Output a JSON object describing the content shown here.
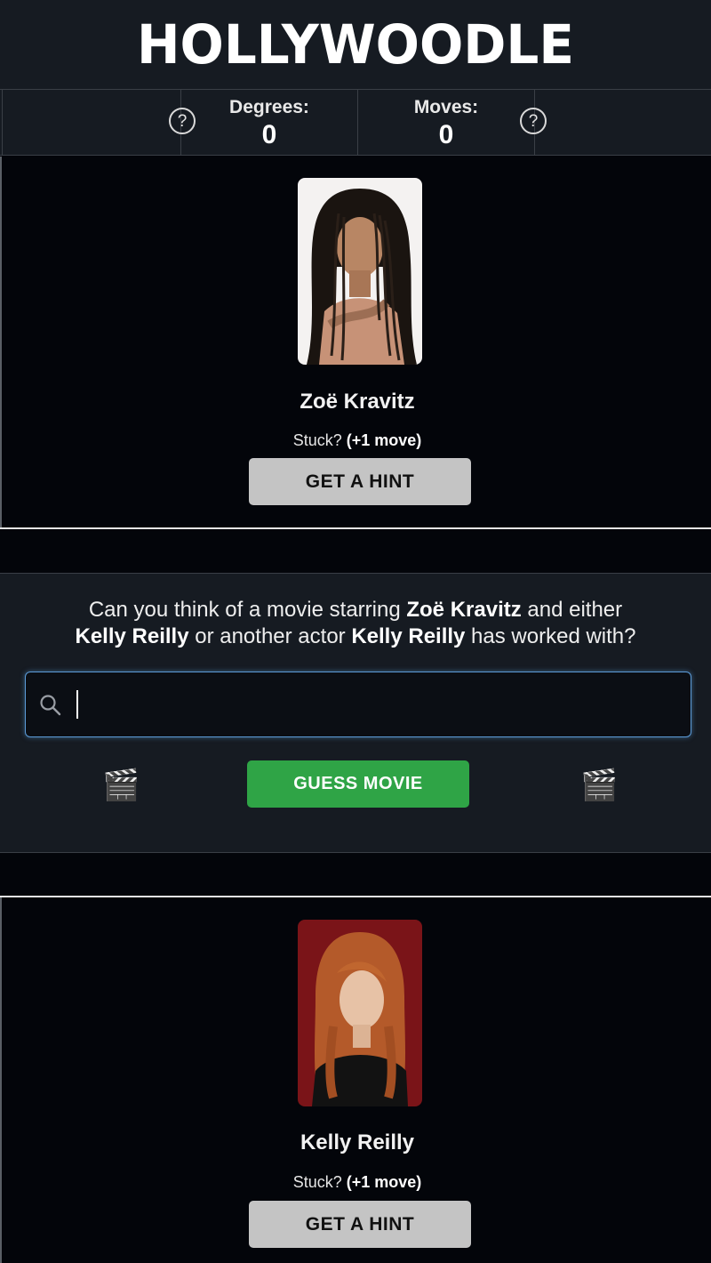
{
  "header": {
    "logo": "HOLLYWOODLE"
  },
  "stats": {
    "degrees_label": "Degrees:",
    "degrees_value": "0",
    "moves_label": "Moves:",
    "moves_value": "0",
    "help_glyph": "?"
  },
  "start_actor": {
    "name": "Zoë Kravitz",
    "stuck_text": "Stuck?",
    "stuck_penalty": "(+1 move)",
    "hint_button": "GET A HINT"
  },
  "guess": {
    "q_part1": "Can you think of a movie starring ",
    "q_actor1": "Zoë Kravitz",
    "q_part2": " and either ",
    "q_actor2": "Kelly Reilly",
    "q_part3": " or another actor ",
    "q_actor3": "Kelly Reilly",
    "q_part4": " has worked with?",
    "input_value": "",
    "button": "GUESS MOVIE",
    "clapper_glyph": "🎬"
  },
  "end_actor": {
    "name": "Kelly Reilly",
    "stuck_text": "Stuck?",
    "stuck_penalty": "(+1 move)",
    "hint_button": "GET A HINT"
  },
  "colors": {
    "background": "#03050a",
    "panel": "#161b22",
    "guess_green": "#2fa446",
    "hint_gray": "#c4c4c4",
    "focus_blue": "#5b9bd8"
  }
}
